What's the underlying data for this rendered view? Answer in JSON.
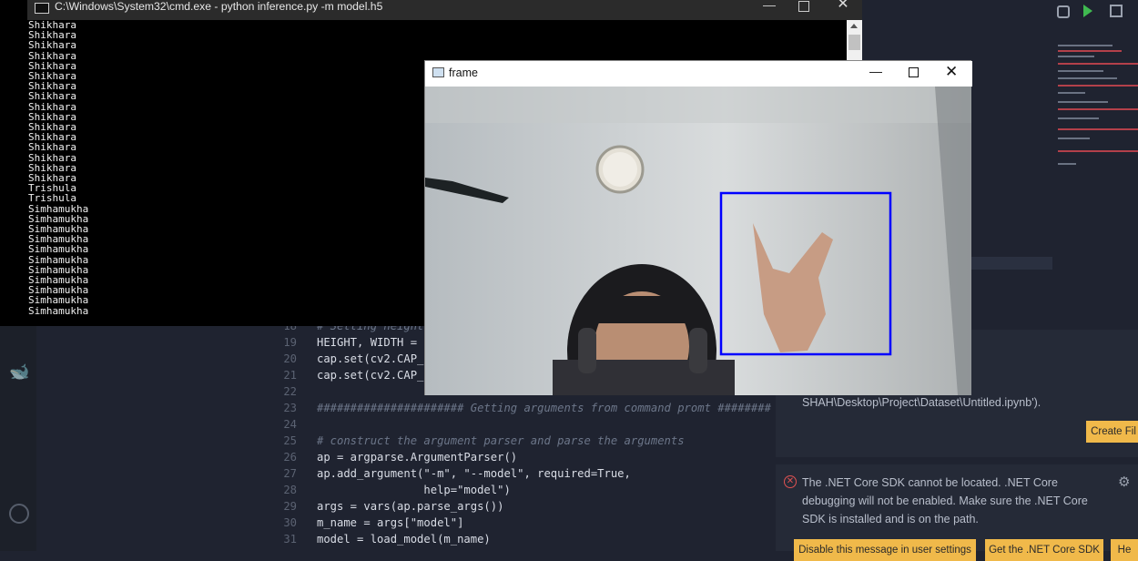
{
  "cmd": {
    "title": "C:\\Windows\\System32\\cmd.exe - python  inference.py -m model.h5",
    "lines": [
      "Shikhara",
      "Shikhara",
      "Shikhara",
      "Shikhara",
      "Shikhara",
      "Shikhara",
      "Shikhara",
      "Shikhara",
      "Shikhara",
      "Shikhara",
      "Shikhara",
      "Shikhara",
      "Shikhara",
      "Shikhara",
      "Shikhara",
      "Shikhara",
      "Trishula",
      "Trishula",
      "Simhamukha",
      "Simhamukha",
      "Simhamukha",
      "Simhamukha",
      "Simhamukha",
      "Simhamukha",
      "Simhamukha",
      "Simhamukha",
      "Simhamukha",
      "Simhamukha",
      "Simhamukha"
    ],
    "minimize_icon": "minimize-icon",
    "maximize_icon": "maximize-icon",
    "close_icon": "close-icon"
  },
  "frame": {
    "title": "frame",
    "detection_box_color": "#0000ff"
  },
  "editor": {
    "lines": [
      {
        "num": "18",
        "text": "# Setting height"
      },
      {
        "num": "19",
        "text": "HEIGHT, WIDTH = "
      },
      {
        "num": "20",
        "text": "cap.set(cv2.CAP_"
      },
      {
        "num": "21",
        "text": "cap.set(cv2.CAP_"
      },
      {
        "num": "22",
        "text": ""
      },
      {
        "num": "23",
        "text": "###################### Getting arguments from command promt ########"
      },
      {
        "num": "24",
        "text": ""
      },
      {
        "num": "25",
        "text": "# construct the argument parser and parse the arguments"
      },
      {
        "num": "26",
        "text": "ap = argparse.ArgumentParser()"
      },
      {
        "num": "27",
        "text": "ap.add_argument(\"-m\", \"--model\", required=True,"
      },
      {
        "num": "28",
        "text": "                help=\"model\")"
      },
      {
        "num": "29",
        "text": "args = vars(ap.parse_args())"
      },
      {
        "num": "30",
        "text": "m_name = args[\"model\"]"
      },
      {
        "num": "31",
        "text": "model = load_model(m_name)"
      }
    ]
  },
  "notifications": {
    "file_error": "nable to read file 'c:\\Users\\KRISH\ntitled.ipynb' (Error: Unable to\nRISH\nSHAH\\Desktop\\Project\\Dataset\\Untitled.ipynb').",
    "create_button": "Create Fil",
    "dotnet_message": "The .NET Core SDK cannot be located. .NET Core debugging will not be enabled. Make sure the .NET Core SDK is installed and is on the path.",
    "disable_button": "Disable this message in user settings",
    "get_sdk_button": "Get the .NET Core SDK",
    "help_button": "He"
  },
  "colors": {
    "accent": "#f0b94a",
    "error": "#e05252"
  }
}
